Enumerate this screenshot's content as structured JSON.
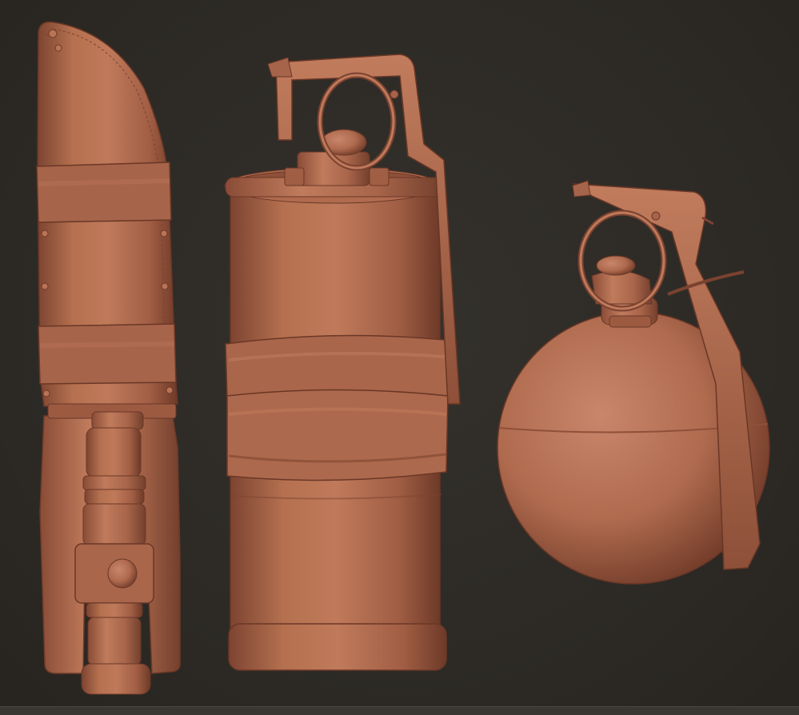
{
  "scene": {
    "background_color": "#2e2b27",
    "clay_color": "#b06a50",
    "clay_shadow": "#7a4230",
    "clay_highlight": "#cf8a6c",
    "objects": [
      {
        "name": "knife-in-sheath"
      },
      {
        "name": "canister-grenade"
      },
      {
        "name": "frag-grenade"
      }
    ]
  }
}
